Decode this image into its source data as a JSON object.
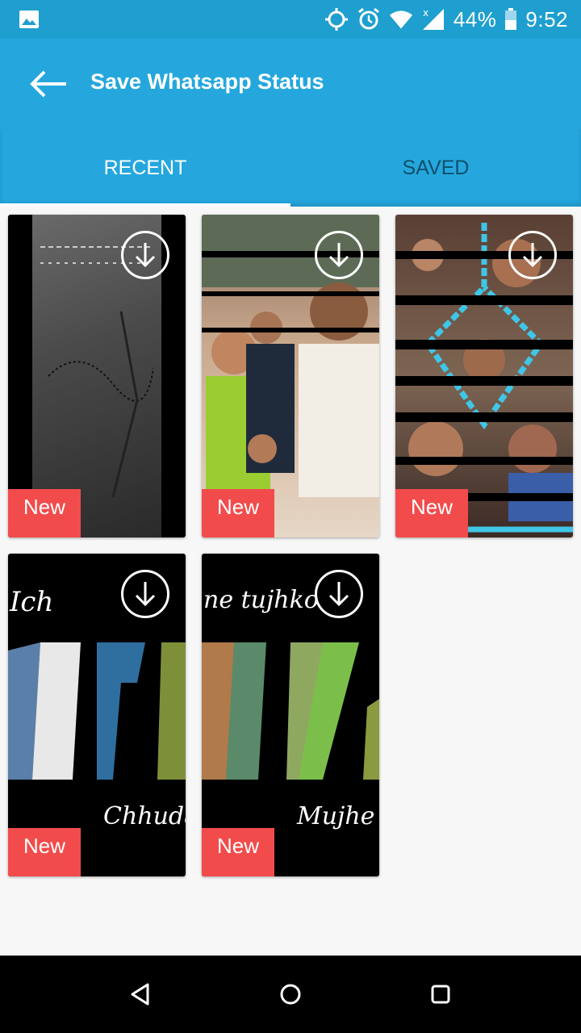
{
  "status_bar": {
    "battery": "44%",
    "time": "9:52",
    "icons": [
      "gallery-icon",
      "gps-icon",
      "alarm-icon",
      "wifi-icon",
      "signal-icon",
      "battery-icon"
    ]
  },
  "app_bar": {
    "title": "Save Whatsapp Status",
    "back_icon": "arrow-left-icon"
  },
  "tabs": [
    {
      "label": "RECENT",
      "selected": true
    },
    {
      "label": "SAVED",
      "selected": false
    }
  ],
  "cards": [
    {
      "badge": "New",
      "download_icon": "download-circle-icon"
    },
    {
      "badge": "New",
      "download_icon": "download-circle-icon"
    },
    {
      "badge": "New",
      "download_icon": "download-circle-icon"
    },
    {
      "badge": "New",
      "download_icon": "download-circle-icon",
      "text_top": "Ich",
      "text_bottom": "Chhudaye"
    },
    {
      "badge": "New",
      "download_icon": "download-circle-icon",
      "text_top": "ne tujhko",
      "text_bottom": "Mujhe"
    }
  ],
  "colors": {
    "status_bar": "#1e9fcf",
    "primary": "#25a7de",
    "badge": "#f24b4b",
    "tab_inactive": "#0d4f6a"
  },
  "nav_bar": {
    "icons": [
      "back-triangle-icon",
      "home-circle-icon",
      "recents-square-icon"
    ]
  }
}
